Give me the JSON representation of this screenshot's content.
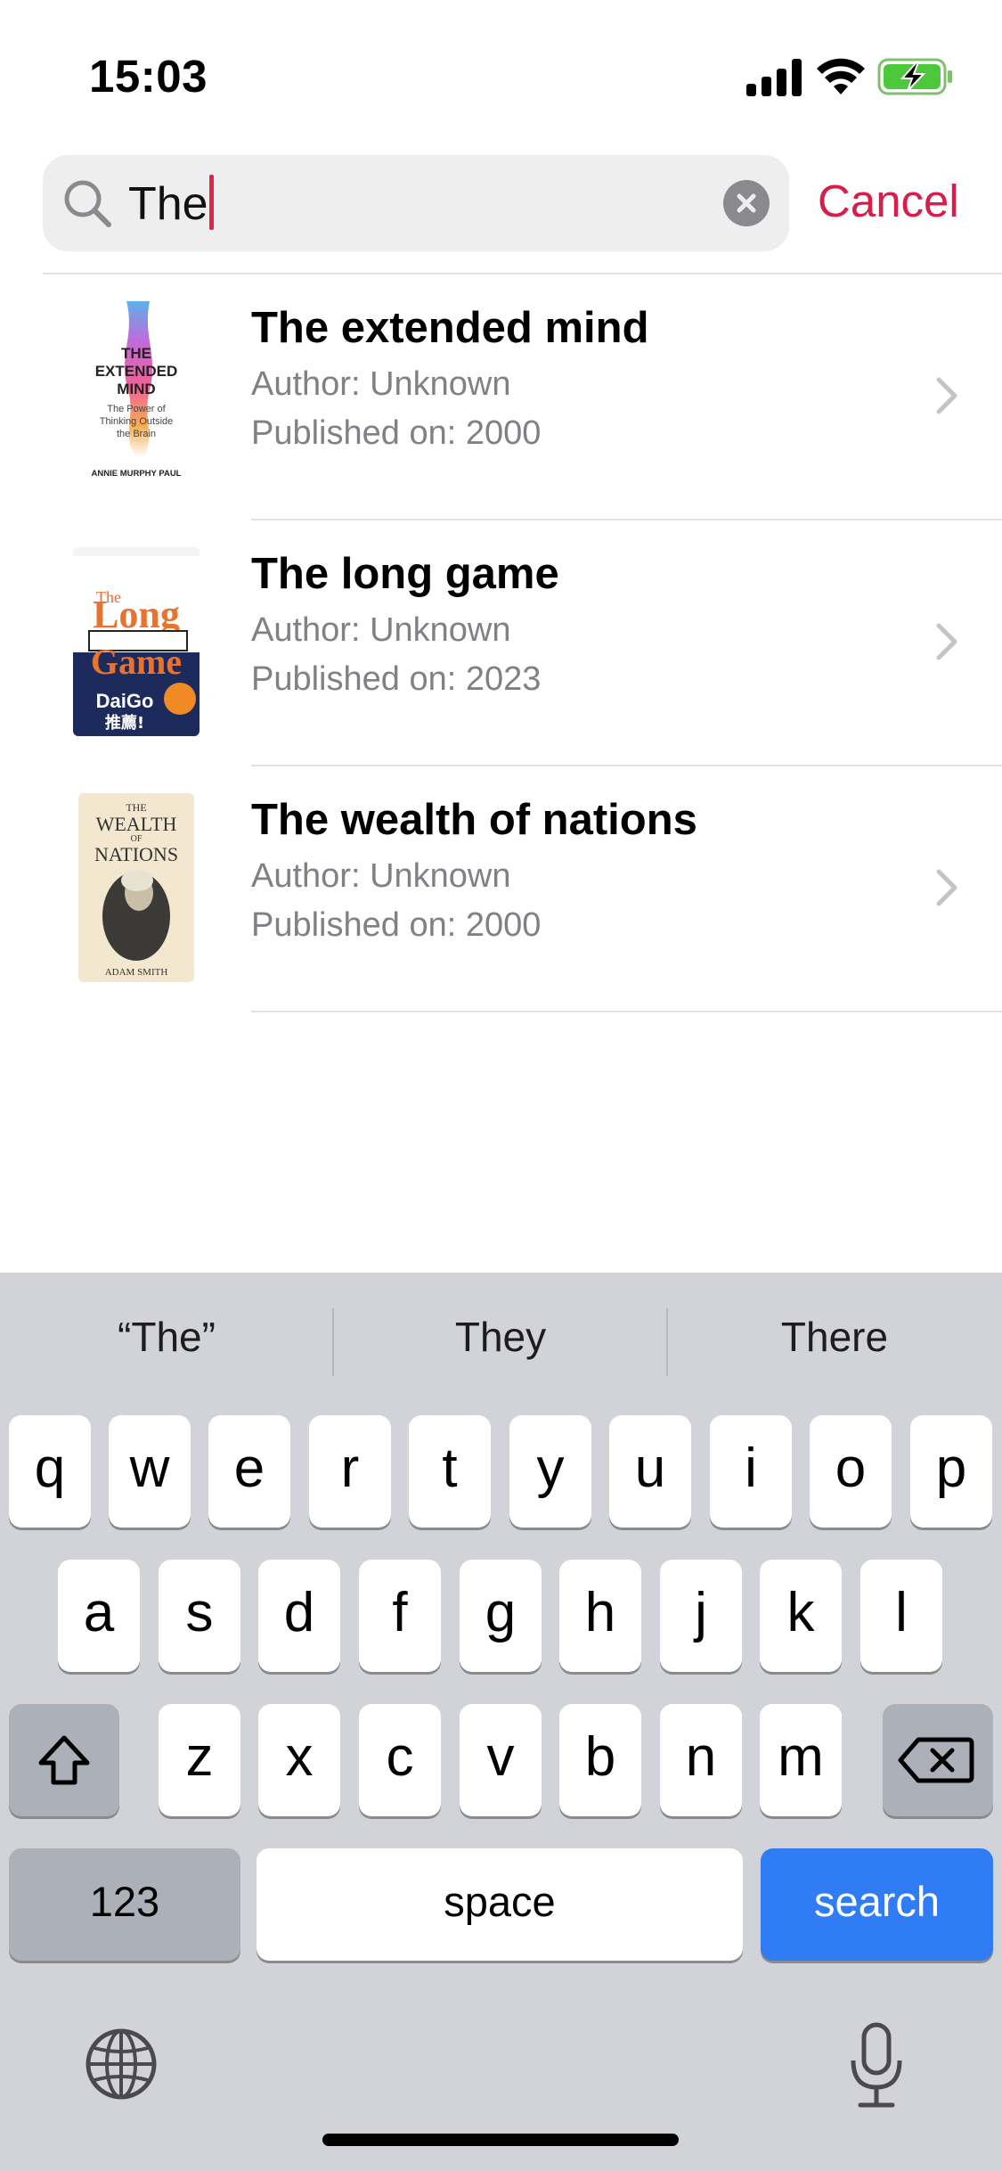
{
  "status_bar": {
    "time": "15:03"
  },
  "search": {
    "query": "The",
    "cancel_label": "Cancel"
  },
  "results": [
    {
      "title": "The extended mind",
      "author": "Author: Unknown",
      "published": "Published on: 2000",
      "cover_lines": [
        "THE",
        "EXTENDED",
        "MIND",
        "The Power of",
        "Thinking Outside",
        "the Brain",
        "ANNIE MURPHY PAUL"
      ]
    },
    {
      "title": "The long game",
      "author": "Author: Unknown",
      "published": "Published on: 2023",
      "cover_lines": [
        "The",
        "Long",
        "Game",
        "DaiGo",
        "推薦!"
      ]
    },
    {
      "title": "The wealth of nations",
      "author": "Author: Unknown",
      "published": "Published on: 2000",
      "cover_lines": [
        "THE",
        "WEALTH",
        "OF",
        "NATIONS",
        "ADAM SMITH"
      ]
    }
  ],
  "keyboard": {
    "suggestions": [
      "“The”",
      "They",
      "There"
    ],
    "row1": [
      "q",
      "w",
      "e",
      "r",
      "t",
      "y",
      "u",
      "i",
      "o",
      "p"
    ],
    "row2": [
      "a",
      "s",
      "d",
      "f",
      "g",
      "h",
      "j",
      "k",
      "l"
    ],
    "row3": [
      "z",
      "x",
      "c",
      "v",
      "b",
      "n",
      "m"
    ],
    "numbers_label": "123",
    "space_label": "space",
    "search_label": "search"
  },
  "colors": {
    "accent": "#d81d4a",
    "search_key": "#2f7cf5",
    "keyboard_bg": "#d1d3d9"
  }
}
